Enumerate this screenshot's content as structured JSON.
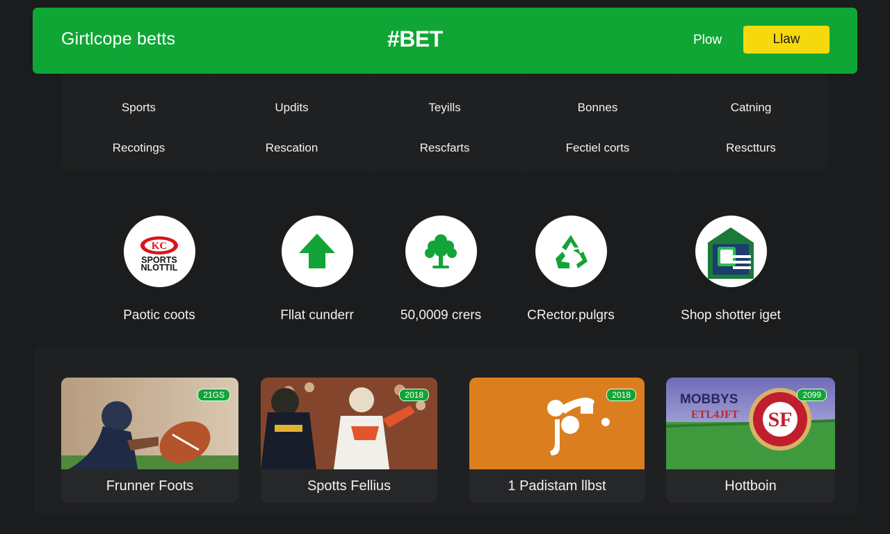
{
  "header": {
    "brand": "Girtlcope betts",
    "logo": "#BET",
    "play_link": "Plow",
    "cta_button": "Llaw"
  },
  "menu": {
    "columns": [
      [
        "Sports",
        "Recotings"
      ],
      [
        "Updits",
        "Rescation"
      ],
      [
        "Teyills",
        "Rescfarts"
      ],
      [
        "Bonnes",
        "Fectiel corts"
      ],
      [
        "Catning",
        "Resctturs"
      ]
    ]
  },
  "features": [
    {
      "label": "Paotic coots",
      "icon": "sports-logo-icon",
      "logo_text": [
        "SPORTS",
        "NLOTTIL"
      ]
    },
    {
      "label": "Fllat cunderr",
      "icon": "arrow-up-icon"
    },
    {
      "label": "50,0009 crers",
      "icon": "tree-icon"
    },
    {
      "label": "CRector.pulgrs",
      "icon": "recycle-icon"
    },
    {
      "label": "Shop shotter iget",
      "icon": "building-icon"
    }
  ],
  "cards": [
    {
      "title": "Frunner Foots",
      "badge": "21GS",
      "image": "football-player-image"
    },
    {
      "title": "Spotts Fellius",
      "badge": "2018",
      "image": "football-players-image"
    },
    {
      "title": "1 Padistam llbst",
      "badge": "2018",
      "image": "music-note-image"
    },
    {
      "title": "Hottboin",
      "badge": "2099",
      "image": "stadium-logo-image",
      "overlay_text": [
        "MOBBYS",
        "ETL4JFT"
      ]
    }
  ],
  "colors": {
    "background": "#1b1c1d",
    "header_green": "#10a636",
    "cta_yellow": "#f5d90c",
    "panel": "#1f2021",
    "icon_green": "#12a436"
  }
}
